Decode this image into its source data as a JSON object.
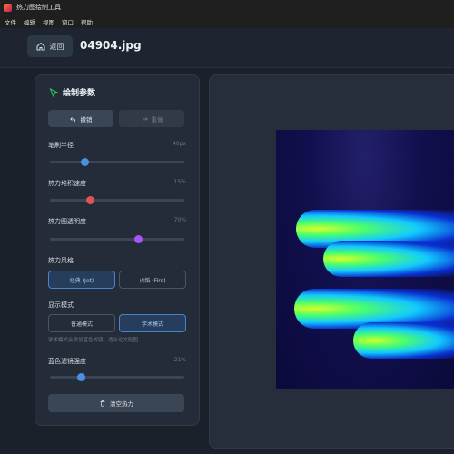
{
  "window": {
    "title": "热力图绘制工具"
  },
  "menu": [
    "文件",
    "编辑",
    "视图",
    "窗口",
    "帮助"
  ],
  "header": {
    "back_label": "返回",
    "file_name": "04904.jpg"
  },
  "panel": {
    "title": "绘制参数",
    "undo_label": "撤销",
    "redo_label": "重做",
    "brush_radius": {
      "label": "笔刷半径",
      "value_text": "40px",
      "fraction": 0.26
    },
    "accumulation_speed": {
      "label": "热力堆积速度",
      "value_text": "15%",
      "fraction": 0.3
    },
    "opacity": {
      "label": "热力图透明度",
      "value_text": "70%",
      "fraction": 0.66
    },
    "style": {
      "label": "热力风格",
      "options": [
        "经典 (Jet)",
        "火焰 (Fire)"
      ],
      "selected": "经典 (Jet)"
    },
    "display_mode": {
      "label": "显示模式",
      "options": [
        "普通模式",
        "学术模式"
      ],
      "selected": "学术模式",
      "hint": "学术模式会添加蓝色滤镜，适合论文配图"
    },
    "blue_filter": {
      "label": "蓝色滤镜强度",
      "value_text": "21%",
      "fraction": 0.23
    },
    "clear_label": "清空热力"
  },
  "colors": {
    "accent": "#4a90e2",
    "red_thumb": "#e05454",
    "purple_thumb": "#a855f7",
    "title_icon": "#22c55e"
  },
  "icons": [
    "home-icon",
    "undo-icon",
    "redo-icon",
    "cursor-icon",
    "trash-icon"
  ]
}
